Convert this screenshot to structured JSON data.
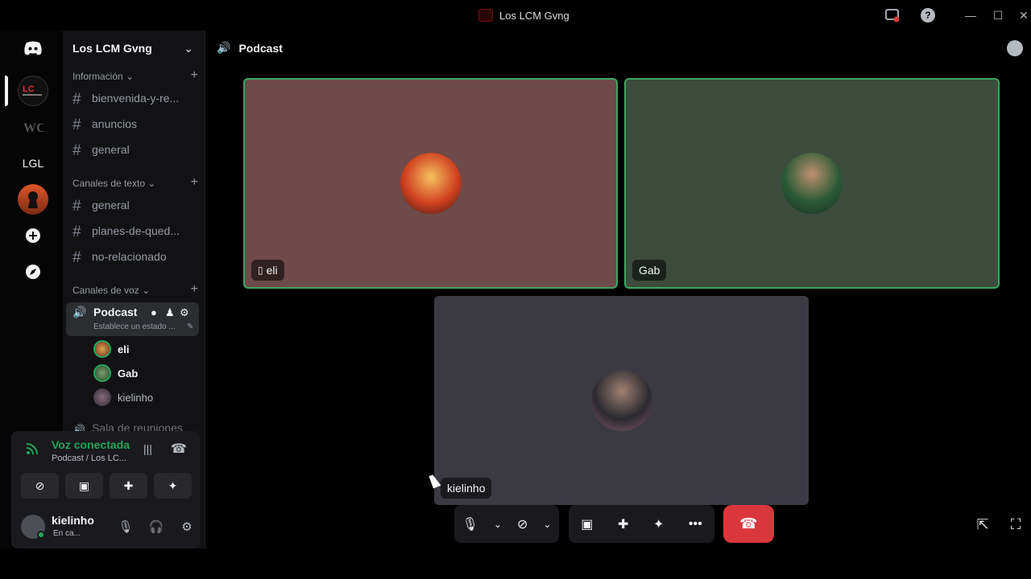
{
  "window": {
    "title": "Los LCM Gvng"
  },
  "rail": {
    "servers": [
      {
        "name": "LGL"
      }
    ]
  },
  "sidebar": {
    "guild_name": "Los LCM Gvng",
    "categories": [
      {
        "label": "Información",
        "channels": [
          "bienvenida-y-re...",
          "anuncios",
          "general"
        ]
      },
      {
        "label": "Canales de texto",
        "channels": [
          "general",
          "planes-de-qued...",
          "no-relacionado"
        ]
      },
      {
        "label": "Canales de voz"
      }
    ],
    "active_voice": {
      "name": "Podcast",
      "status": "Establece un estado ...",
      "users": [
        "eli",
        "Gab",
        "kielinho"
      ]
    },
    "next_voice": "Sala de reuniones"
  },
  "voice_panel": {
    "title": "Voz conectada",
    "subtitle": "Podcast / Los LC..."
  },
  "user": {
    "name": "kielinho",
    "status": "En ca..."
  },
  "stage": {
    "channel": "Podcast",
    "tiles": [
      {
        "label": "eli",
        "bg": "#6e4a49"
      },
      {
        "label": "Gab",
        "bg": "#3c4c3c"
      },
      {
        "label": "kielinho",
        "bg": "#3b3a43"
      }
    ]
  },
  "colors": {
    "accent_green": "#23a55a",
    "hangup_red": "#da373c"
  }
}
